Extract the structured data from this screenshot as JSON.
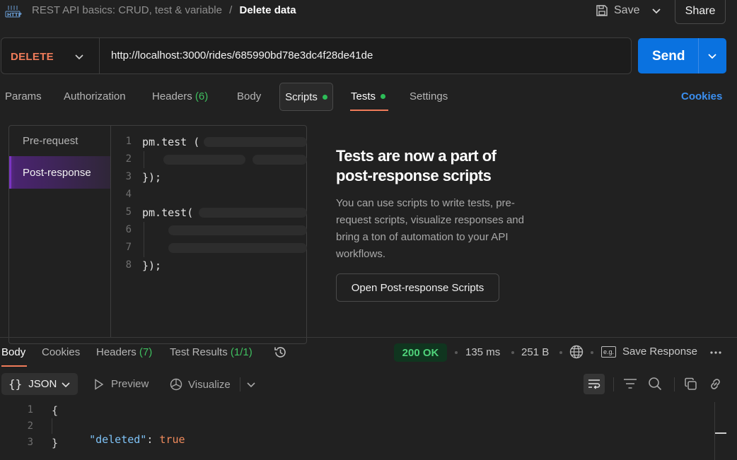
{
  "header": {
    "http_badge": "HTTP",
    "collection": "REST API basics: CRUD, test & variable",
    "separator": "/",
    "request_name": "Delete data",
    "save_label": "Save",
    "share_label": "Share"
  },
  "request": {
    "method": "DELETE",
    "url": "http://localhost:3000/rides/685990bd78e3dc4f28de41de",
    "send_label": "Send"
  },
  "request_tabs": {
    "params": "Params",
    "authorization": "Authorization",
    "headers": "Headers",
    "headers_count": "(6)",
    "body": "Body",
    "scripts": "Scripts",
    "tests": "Tests",
    "settings": "Settings",
    "cookies": "Cookies",
    "active": "Tests"
  },
  "scripts_panel": {
    "pre_request": "Pre-request",
    "post_response": "Post-response",
    "lines": [
      {
        "num": "1",
        "code": "pm.test ("
      },
      {
        "num": "2",
        "code": ""
      },
      {
        "num": "3",
        "code": "});"
      },
      {
        "num": "4",
        "code": ""
      },
      {
        "num": "5",
        "code": "pm.test("
      },
      {
        "num": "6",
        "code": ""
      },
      {
        "num": "7",
        "code": ""
      },
      {
        "num": "8",
        "code": "});"
      }
    ]
  },
  "info": {
    "title_line1": "Tests are now a part of",
    "title_line2": "post-response scripts",
    "body_line1": "You can use scripts to write tests, pre-",
    "body_line2": "request scripts, visualize responses and",
    "body_line3": "bring a ton of automation to your API",
    "body_line4": "workflows.",
    "button": "Open Post-response Scripts"
  },
  "response_tabs": {
    "body": "Body",
    "cookies": "Cookies",
    "headers": "Headers",
    "headers_count": "(7)",
    "test_results": "Test Results",
    "test_results_count": "(1/1)",
    "active": "Body"
  },
  "response_meta": {
    "status": "200 OK",
    "time": "135 ms",
    "size": "251 B",
    "save_response": "Save Response",
    "eg_badge": "e.g."
  },
  "response_toolbar": {
    "format": "JSON",
    "preview": "Preview",
    "visualize": "Visualize"
  },
  "response_body": {
    "lines": [
      {
        "num": "1",
        "text": "{"
      },
      {
        "num": "2",
        "key": "\"deleted\"",
        "colon": ": ",
        "value": "true"
      },
      {
        "num": "3",
        "text": "}"
      }
    ]
  },
  "colors": {
    "accent_blue": "#0a72e0",
    "method_delete": "#f07c5a",
    "status_ok": "#4fd27a",
    "tab_underline": "#f07c5a",
    "active_script_tab": "#5b2a86"
  }
}
